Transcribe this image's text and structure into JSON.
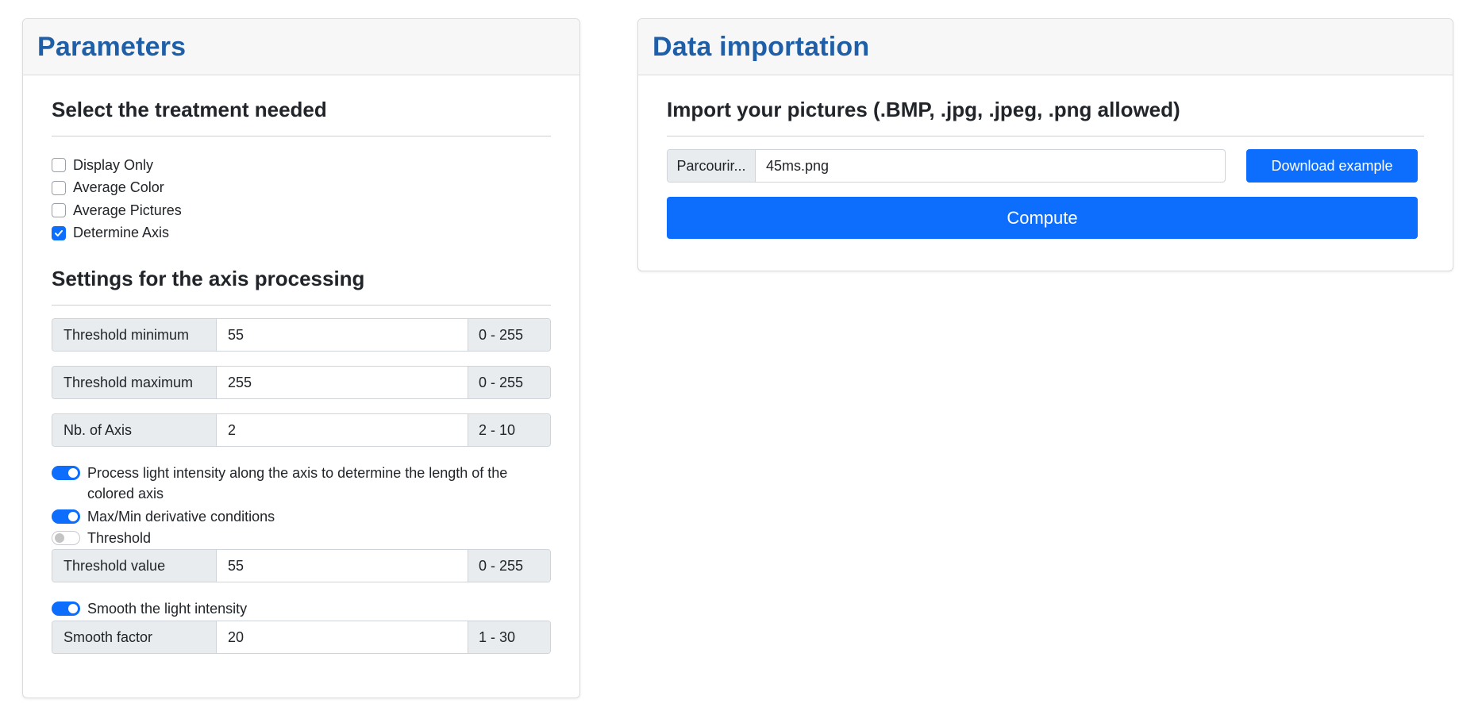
{
  "parameters": {
    "title": "Parameters",
    "treatment": {
      "heading": "Select the treatment needed",
      "options": [
        {
          "label": "Display Only",
          "checked": false
        },
        {
          "label": "Average Color",
          "checked": false
        },
        {
          "label": "Average Pictures",
          "checked": false
        },
        {
          "label": "Determine Axis",
          "checked": true
        }
      ]
    },
    "axis_settings": {
      "heading": "Settings for the axis processing",
      "threshold_min": {
        "label": "Threshold minimum",
        "value": "55",
        "range": "0 - 255"
      },
      "threshold_max": {
        "label": "Threshold maximum",
        "value": "255",
        "range": "0 - 255"
      },
      "nb_axis": {
        "label": "Nb. of Axis",
        "value": "2",
        "range": "2 - 10"
      },
      "toggle_light": {
        "label": "Process light intensity along the axis to determine the length of the colored axis",
        "on": true
      },
      "toggle_derivative": {
        "label": "Max/Min derivative conditions",
        "on": true
      },
      "toggle_threshold": {
        "label": "Threshold",
        "on": false
      },
      "threshold_value": {
        "label": "Threshold value",
        "value": "55",
        "range": "0 - 255"
      },
      "toggle_smooth": {
        "label": "Smooth the light intensity",
        "on": true
      },
      "smooth_factor": {
        "label": "Smooth factor",
        "value": "20",
        "range": "1 - 30"
      }
    }
  },
  "import": {
    "title": "Data importation",
    "heading": "Import your pictures (.BMP, .jpg, .jpeg, .png allowed)",
    "browse_label": "Parcourir...",
    "file_name": "45ms.png",
    "download_label": "Download example",
    "compute_label": "Compute"
  },
  "colors": {
    "accent": "#0d6efd",
    "title": "#1f5fa8"
  }
}
